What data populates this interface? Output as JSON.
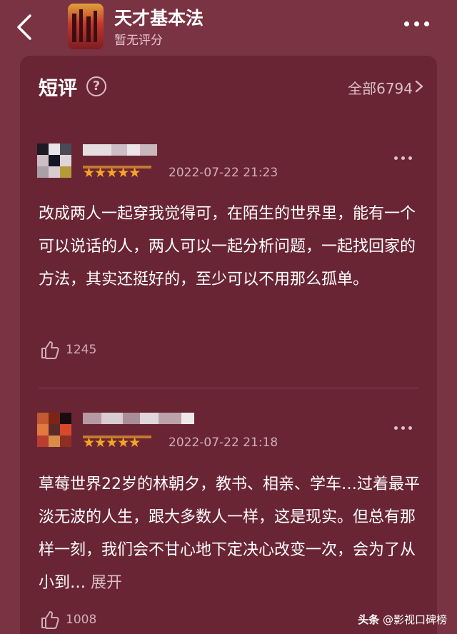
{
  "header": {
    "title": "天才基本法",
    "subtitle": "暂无评分"
  },
  "section": {
    "title": "短评",
    "all_link": "全部6794"
  },
  "reviews": [
    {
      "stars": "★★★★★",
      "rating": 5,
      "date": "2022-07-22 21:23",
      "text": "改成两人一起穿我觉得可，在陌生的世界里，能有一个可以说话的人，两人可以一起分析问题，一起找回家的方法，其实还挺好的，至少可以不用那么孤单。",
      "likes": "1245"
    },
    {
      "stars": "★★★★★",
      "rating": 5,
      "date": "2022-07-22 21:18",
      "text": "草莓世界22岁的林朝夕，教书、相亲、学车…过着最平淡无波的人生，跟大多数人一样，这是现实。但总有那样一刻，我们会不甘心地下定决心改变一次，会为了从小到…",
      "expand": "展开",
      "likes": "1008"
    }
  ],
  "watermark": {
    "brand": "头条",
    "account": "@影视口碑榜"
  },
  "colors": {
    "background": "#7a3343",
    "card": "#6a2535",
    "star": "#f5a524"
  }
}
